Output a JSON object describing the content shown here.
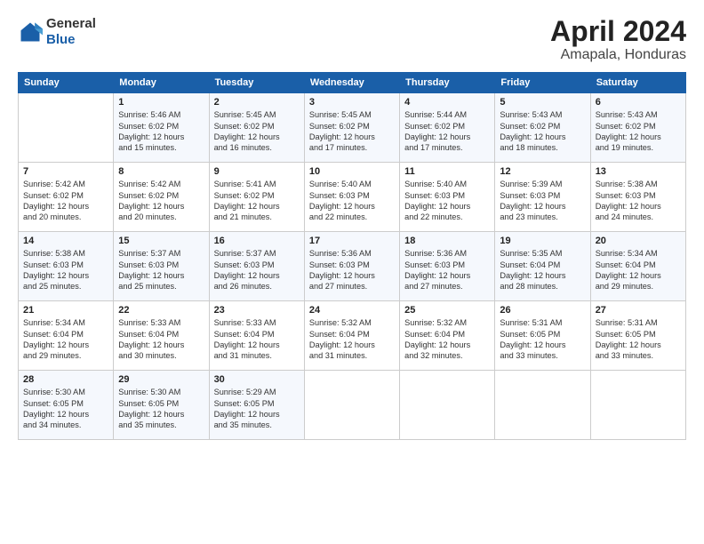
{
  "header": {
    "logo": {
      "general": "General",
      "blue": "Blue"
    },
    "title": "April 2024",
    "location": "Amapala, Honduras"
  },
  "weekdays": [
    "Sunday",
    "Monday",
    "Tuesday",
    "Wednesday",
    "Thursday",
    "Friday",
    "Saturday"
  ],
  "weeks": [
    [
      {
        "day": null,
        "info": null
      },
      {
        "day": "1",
        "info": "Sunrise: 5:46 AM\nSunset: 6:02 PM\nDaylight: 12 hours\nand 15 minutes."
      },
      {
        "day": "2",
        "info": "Sunrise: 5:45 AM\nSunset: 6:02 PM\nDaylight: 12 hours\nand 16 minutes."
      },
      {
        "day": "3",
        "info": "Sunrise: 5:45 AM\nSunset: 6:02 PM\nDaylight: 12 hours\nand 17 minutes."
      },
      {
        "day": "4",
        "info": "Sunrise: 5:44 AM\nSunset: 6:02 PM\nDaylight: 12 hours\nand 17 minutes."
      },
      {
        "day": "5",
        "info": "Sunrise: 5:43 AM\nSunset: 6:02 PM\nDaylight: 12 hours\nand 18 minutes."
      },
      {
        "day": "6",
        "info": "Sunrise: 5:43 AM\nSunset: 6:02 PM\nDaylight: 12 hours\nand 19 minutes."
      }
    ],
    [
      {
        "day": "7",
        "info": "Sunrise: 5:42 AM\nSunset: 6:02 PM\nDaylight: 12 hours\nand 20 minutes."
      },
      {
        "day": "8",
        "info": "Sunrise: 5:42 AM\nSunset: 6:02 PM\nDaylight: 12 hours\nand 20 minutes."
      },
      {
        "day": "9",
        "info": "Sunrise: 5:41 AM\nSunset: 6:02 PM\nDaylight: 12 hours\nand 21 minutes."
      },
      {
        "day": "10",
        "info": "Sunrise: 5:40 AM\nSunset: 6:03 PM\nDaylight: 12 hours\nand 22 minutes."
      },
      {
        "day": "11",
        "info": "Sunrise: 5:40 AM\nSunset: 6:03 PM\nDaylight: 12 hours\nand 22 minutes."
      },
      {
        "day": "12",
        "info": "Sunrise: 5:39 AM\nSunset: 6:03 PM\nDaylight: 12 hours\nand 23 minutes."
      },
      {
        "day": "13",
        "info": "Sunrise: 5:38 AM\nSunset: 6:03 PM\nDaylight: 12 hours\nand 24 minutes."
      }
    ],
    [
      {
        "day": "14",
        "info": "Sunrise: 5:38 AM\nSunset: 6:03 PM\nDaylight: 12 hours\nand 25 minutes."
      },
      {
        "day": "15",
        "info": "Sunrise: 5:37 AM\nSunset: 6:03 PM\nDaylight: 12 hours\nand 25 minutes."
      },
      {
        "day": "16",
        "info": "Sunrise: 5:37 AM\nSunset: 6:03 PM\nDaylight: 12 hours\nand 26 minutes."
      },
      {
        "day": "17",
        "info": "Sunrise: 5:36 AM\nSunset: 6:03 PM\nDaylight: 12 hours\nand 27 minutes."
      },
      {
        "day": "18",
        "info": "Sunrise: 5:36 AM\nSunset: 6:03 PM\nDaylight: 12 hours\nand 27 minutes."
      },
      {
        "day": "19",
        "info": "Sunrise: 5:35 AM\nSunset: 6:04 PM\nDaylight: 12 hours\nand 28 minutes."
      },
      {
        "day": "20",
        "info": "Sunrise: 5:34 AM\nSunset: 6:04 PM\nDaylight: 12 hours\nand 29 minutes."
      }
    ],
    [
      {
        "day": "21",
        "info": "Sunrise: 5:34 AM\nSunset: 6:04 PM\nDaylight: 12 hours\nand 29 minutes."
      },
      {
        "day": "22",
        "info": "Sunrise: 5:33 AM\nSunset: 6:04 PM\nDaylight: 12 hours\nand 30 minutes."
      },
      {
        "day": "23",
        "info": "Sunrise: 5:33 AM\nSunset: 6:04 PM\nDaylight: 12 hours\nand 31 minutes."
      },
      {
        "day": "24",
        "info": "Sunrise: 5:32 AM\nSunset: 6:04 PM\nDaylight: 12 hours\nand 31 minutes."
      },
      {
        "day": "25",
        "info": "Sunrise: 5:32 AM\nSunset: 6:04 PM\nDaylight: 12 hours\nand 32 minutes."
      },
      {
        "day": "26",
        "info": "Sunrise: 5:31 AM\nSunset: 6:05 PM\nDaylight: 12 hours\nand 33 minutes."
      },
      {
        "day": "27",
        "info": "Sunrise: 5:31 AM\nSunset: 6:05 PM\nDaylight: 12 hours\nand 33 minutes."
      }
    ],
    [
      {
        "day": "28",
        "info": "Sunrise: 5:30 AM\nSunset: 6:05 PM\nDaylight: 12 hours\nand 34 minutes."
      },
      {
        "day": "29",
        "info": "Sunrise: 5:30 AM\nSunset: 6:05 PM\nDaylight: 12 hours\nand 35 minutes."
      },
      {
        "day": "30",
        "info": "Sunrise: 5:29 AM\nSunset: 6:05 PM\nDaylight: 12 hours\nand 35 minutes."
      },
      {
        "day": null,
        "info": null
      },
      {
        "day": null,
        "info": null
      },
      {
        "day": null,
        "info": null
      },
      {
        "day": null,
        "info": null
      }
    ]
  ]
}
